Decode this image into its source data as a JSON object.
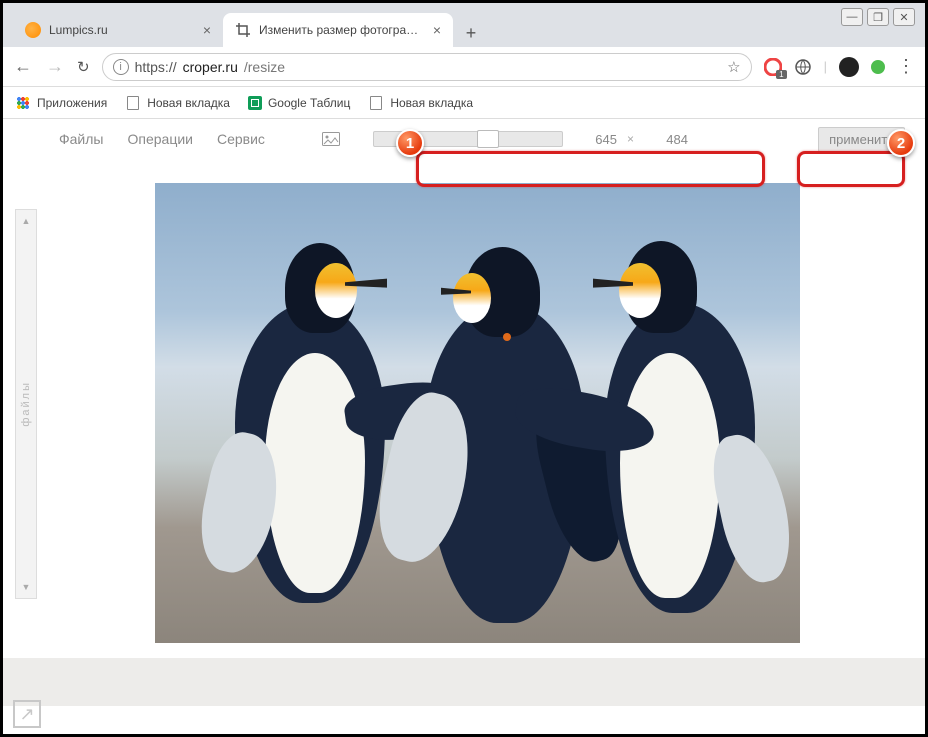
{
  "window": {
    "minimize": "—",
    "maximize": "❐",
    "close": "✕"
  },
  "tabs": [
    {
      "title": "Lumpics.ru",
      "active": false
    },
    {
      "title": "Изменить размер фотографии",
      "active": true
    }
  ],
  "new_tab": "+",
  "nav": {
    "back": "←",
    "forward": "→",
    "reload": "↻"
  },
  "url": {
    "protocol": "https://",
    "domain": "croper.ru",
    "path": "/resize",
    "info": "i",
    "star": "☆"
  },
  "extensions": {
    "badge1": "1"
  },
  "bookmarks": [
    {
      "label": "Приложения",
      "icon": "apps"
    },
    {
      "label": "Новая вкладка",
      "icon": "doc"
    },
    {
      "label": "Google Таблиц",
      "icon": "sheets"
    },
    {
      "label": "Новая вкладка",
      "icon": "doc"
    }
  ],
  "app_menu": {
    "files": "Файлы",
    "operations": "Операции",
    "service": "Сервис"
  },
  "resize": {
    "width": "645",
    "sep": "×",
    "height": "484",
    "slider_position_pct": 55
  },
  "apply_label": "применить",
  "sidebar": {
    "label": "файлы",
    "up": "▲",
    "down": "▼"
  },
  "annotations": {
    "marker1": "1",
    "marker2": "2"
  },
  "corner_link": "↗"
}
